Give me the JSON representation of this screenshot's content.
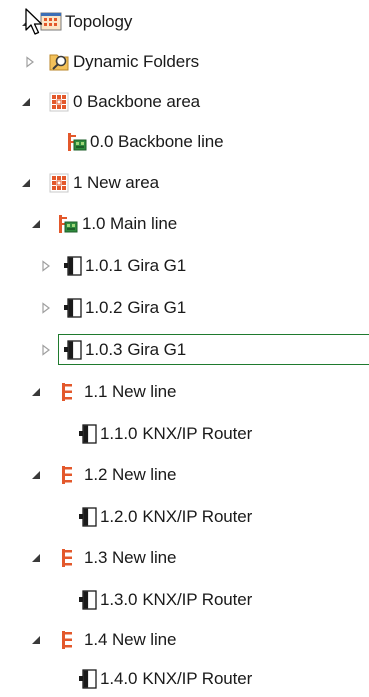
{
  "tree": {
    "nodes": [
      {
        "label": "Topology",
        "expander": "expanded",
        "icon": "topology-icon"
      },
      {
        "label": "Dynamic Folders",
        "expander": "collapsed",
        "icon": "dynamic-folder-icon"
      },
      {
        "label": "0 Backbone area",
        "expander": "expanded",
        "icon": "area-icon"
      },
      {
        "label": "0.0 Backbone line",
        "expander": "none",
        "icon": "main-line-icon"
      },
      {
        "label": "1 New area",
        "expander": "expanded",
        "icon": "area-icon"
      },
      {
        "label": "1.0 Main line",
        "expander": "expanded",
        "icon": "main-line-icon"
      },
      {
        "address": "1.0.1",
        "name": "Gira G1",
        "expander": "collapsed",
        "icon": "device-icon"
      },
      {
        "address": "1.0.2",
        "name": "Gira G1",
        "expander": "collapsed",
        "icon": "device-icon"
      },
      {
        "address": "1.0.3",
        "name": "Gira G1",
        "expander": "collapsed",
        "icon": "device-icon",
        "selected": true
      },
      {
        "label": "1.1 New line",
        "expander": "expanded",
        "icon": "line-icon"
      },
      {
        "address": "1.1.0",
        "name": "KNX/IP Router",
        "expander": "none",
        "icon": "device-icon"
      },
      {
        "label": "1.2 New line",
        "expander": "expanded",
        "icon": "line-icon"
      },
      {
        "address": "1.2.0",
        "name": "KNX/IP Router",
        "expander": "none",
        "icon": "device-icon"
      },
      {
        "label": "1.3 New line",
        "expander": "expanded",
        "icon": "line-icon"
      },
      {
        "address": "1.3.0",
        "name": "KNX/IP Router",
        "expander": "none",
        "icon": "device-icon"
      },
      {
        "label": "1.4 New line",
        "expander": "expanded",
        "icon": "line-icon"
      },
      {
        "address": "1.4.0",
        "name": "KNX/IP Router",
        "expander": "none",
        "icon": "device-icon"
      }
    ]
  },
  "colors": {
    "selection_border": "#1f7a2e",
    "area_icon": "#e3582b",
    "line_icon": "#e3582b",
    "expander": "#3a3a3a",
    "collapsed_expander": "#a0a0a0"
  }
}
